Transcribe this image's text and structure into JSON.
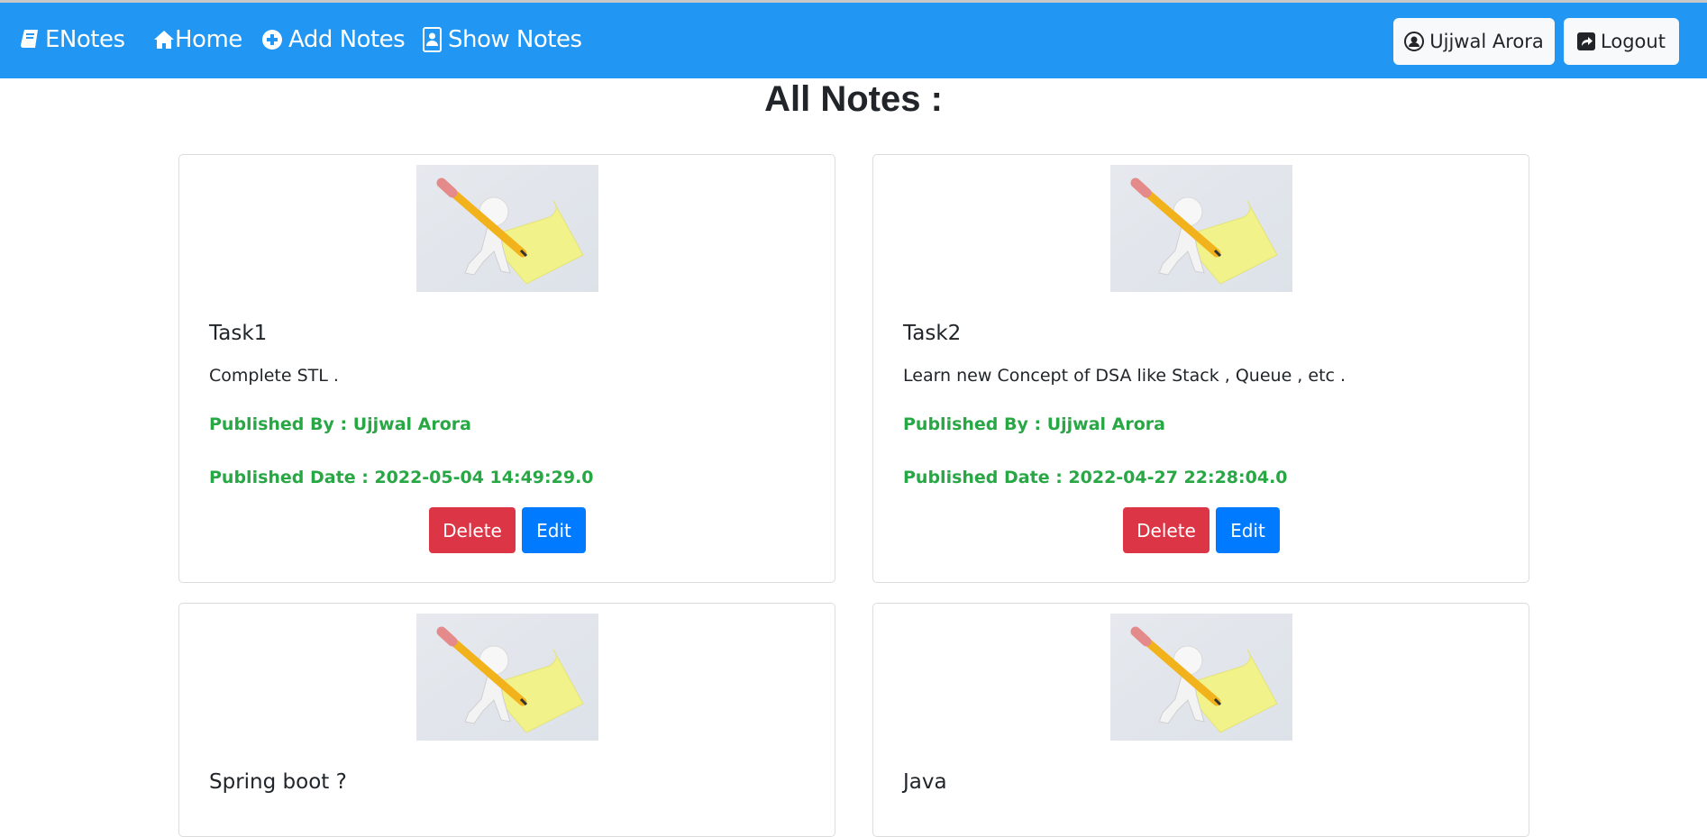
{
  "navbar": {
    "brand": "ENotes",
    "links": [
      "Home",
      "Add Notes",
      "Show Notes"
    ],
    "user": "Ujjwal Arora",
    "logout": "Logout",
    "color": "#2196f3"
  },
  "page_title": "All Notes :",
  "notes": [
    {
      "title": "Task1",
      "content": "Complete STL .",
      "published_by": "Published By : Ujjwal Arora",
      "published_date": "Published Date : 2022-05-04 14:49:29.0",
      "delete": "Delete",
      "edit": "Edit"
    },
    {
      "title": "Task2",
      "content": "Learn new Concept of DSA like Stack , Queue , etc .",
      "published_by": "Published By : Ujjwal Arora",
      "published_date": "Published Date : 2022-04-27 22:28:04.0",
      "delete": "Delete",
      "edit": "Edit"
    },
    {
      "title": "Spring boot ?"
    },
    {
      "title": "Java"
    }
  ]
}
